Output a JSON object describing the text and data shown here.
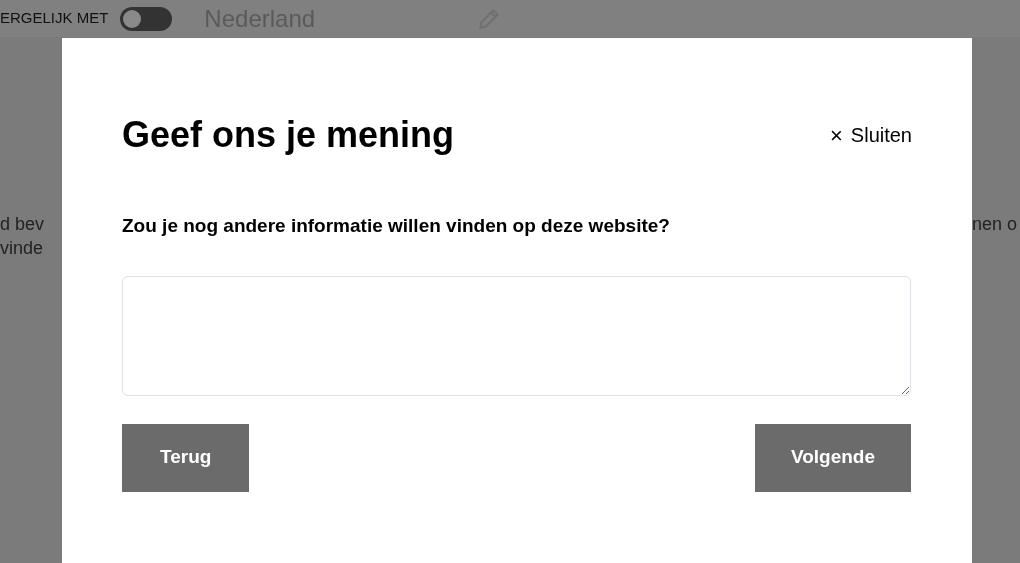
{
  "background": {
    "compare_label": "ERGELIJK MET",
    "compare_toggle": {
      "on": false
    },
    "country_placeholder": "Nederland",
    "left_text": [
      "d bev",
      "vinde"
    ],
    "right_text": [
      "nen o"
    ]
  },
  "dialog": {
    "title": "Geef ons je mening",
    "close_label": "Sluiten",
    "close_icon": "×",
    "question": "Zou je nog andere informatie willen vinden op deze website?",
    "buttons": [
      {
        "kind": "back",
        "label": "Terug"
      },
      {
        "kind": "next",
        "label": "Volgende"
      }
    ]
  }
}
